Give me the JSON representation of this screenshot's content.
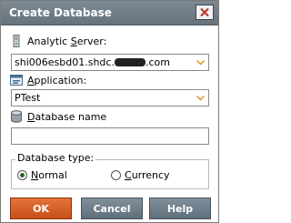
{
  "window": {
    "title": "Create Database",
    "accent": "#66737d"
  },
  "server": {
    "label_prefix": "Analytic ",
    "label_mnemonic": "S",
    "label_suffix": "erver:",
    "value_prefix": "shi006esbd01.shdc.",
    "value_suffix": ".com"
  },
  "application": {
    "label_mnemonic": "A",
    "label_suffix": "pplication:",
    "value": "PTest"
  },
  "database_name": {
    "label_mnemonic": "D",
    "label_suffix": "atabase name",
    "value": ""
  },
  "database_type": {
    "label": "Database type:",
    "options": [
      {
        "mnemonic": "N",
        "rest": "ormal",
        "selected": true
      },
      {
        "mnemonic": "C",
        "rest": "urrency",
        "selected": false
      }
    ]
  },
  "buttons": {
    "ok": "OK",
    "cancel": "Cancel",
    "help": "Help",
    "ok_color": "#d85f28"
  },
  "icons": {
    "server": "server-icon",
    "application": "application-icon",
    "database": "database-icon",
    "close": "close-icon",
    "dropdown": "chevron-down-icon"
  }
}
